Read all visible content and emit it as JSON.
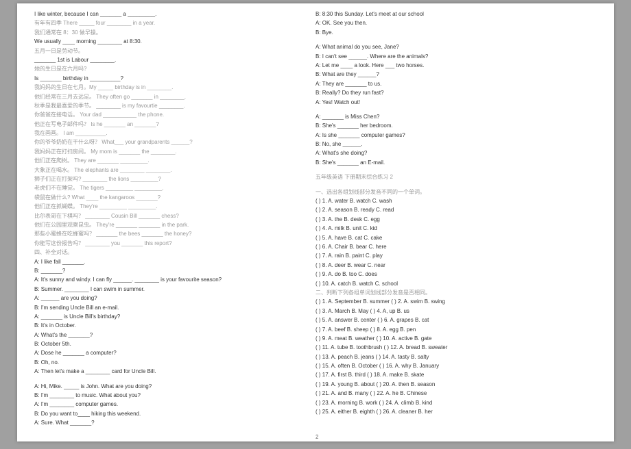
{
  "pageNum": "2",
  "left": [
    {
      "t": "I like winter, because I can _______ a _________.",
      "c": ""
    },
    {
      "t": "有年有四季    There _____ four ________ in a year.",
      "c": "gray"
    },
    {
      "t": "我们通常在 8：30 做早操。",
      "c": "gray"
    },
    {
      "t": "We usually ____ morning ________ at 8:30.",
      "c": ""
    },
    {
      "t": "五月一日是劳动节。",
      "c": "gray"
    },
    {
      "t": "_______ 1st is Labour ________.",
      "c": ""
    },
    {
      "t": "她的生日是在六月吗?",
      "c": "gray"
    },
    {
      "t": "Is _______ birthday in __________?",
      "c": ""
    },
    {
      "t": "我妈妈的生日在七月。My _____ birthday is in ________.",
      "c": "gray"
    },
    {
      "t": "他们经常在三月去远足。    They often go _______ in ________.",
      "c": "gray"
    },
    {
      "t": "秋季是我最喜爱的季节。    ________ is my favourtie ________.",
      "c": "gray"
    },
    {
      "t": "你爸爸在接电话。     Your dad ___________ the phone.",
      "c": "gray"
    },
    {
      "t": "他正在写电子邮件吗？    Is he _______ an _______?",
      "c": "gray"
    },
    {
      "t": "我在画画。    I am __________.",
      "c": "gray"
    },
    {
      "t": "你的爷爷奶奶在干什么呀？    What___ your grandparents ______?",
      "c": "gray"
    },
    {
      "t": "我妈妈正在打扫房间。    My mom is _______ the ________.",
      "c": "gray"
    },
    {
      "t": "他们正在爬树。    They are _______ _________.",
      "c": "gray"
    },
    {
      "t": "大象正在喝水。    The elephants are ________ ________.",
      "c": "gray"
    },
    {
      "t": "狮子们正在打架吗?    ________ the lions _________?",
      "c": "gray"
    },
    {
      "t": "老虎们不在睡觉。    The tigers _________ _________.",
      "c": "gray"
    },
    {
      "t": "袋鼠在做什么?    What ____ the kangaroos _______?",
      "c": "gray"
    },
    {
      "t": "他们正在抓蝴蝶。    They're _________ _________.",
      "c": "gray"
    },
    {
      "t": "比尔表哥在下棋吗？    ________ Cousin Bill _______ chess?",
      "c": "gray"
    },
    {
      "t": "他们在公园里观察昆虫。    They're _______ _______ in the park.",
      "c": "gray"
    },
    {
      "t": "那些小蜜蜂在吃蜂蜜吗？    _______ the bees _______ the honey?",
      "c": "gray"
    },
    {
      "t": "你能写这份报告吗？     ________ you _______ this report?",
      "c": "gray"
    },
    {
      "t": "四、补全对话。",
      "c": "gray"
    },
    {
      "t": "A: I like fall _______.",
      "c": ""
    },
    {
      "t": "B: _______?",
      "c": ""
    },
    {
      "t": "A: It's sunny and windy. I can fly ______. ________ is your favourite season?",
      "c": ""
    },
    {
      "t": "B: Summer. ________ I can swim in summer.",
      "c": ""
    },
    {
      "t": "A: ______ are you doing?",
      "c": ""
    },
    {
      "t": "B: I'm sending Uncle Bill an e-mail.",
      "c": ""
    },
    {
      "t": "A: _______ is Uncle Bill's birthday?",
      "c": ""
    },
    {
      "t": "B: It's in October.",
      "c": ""
    },
    {
      "t": "A: What's the _______?",
      "c": ""
    },
    {
      "t": "B: October 5th.",
      "c": ""
    },
    {
      "t": "A: Dose he _______ a computer?",
      "c": ""
    },
    {
      "t": "B: Oh, no.",
      "c": ""
    },
    {
      "t": "A: Then let's make a ________ card for Uncle Bill.",
      "c": ""
    },
    {
      "t": "",
      "c": "spacer"
    },
    {
      "t": "A: Hi, Mike. _____ is John. What are you doing?",
      "c": ""
    },
    {
      "t": "B: I'm ________ to music. What about you?",
      "c": ""
    },
    {
      "t": "A: I'm ________ computer games.",
      "c": ""
    },
    {
      "t": "B: Do you want to____ hiking this weekend.",
      "c": ""
    },
    {
      "t": "A: Sure. What _______?",
      "c": ""
    }
  ],
  "right": [
    {
      "t": "B: 8:30 this Sunday. Let's meet at our school",
      "c": ""
    },
    {
      "t": "A: OK. See you then.",
      "c": ""
    },
    {
      "t": "B: Bye.",
      "c": ""
    },
    {
      "t": "",
      "c": "spacer"
    },
    {
      "t": "A: What animal do you see, Jane?",
      "c": ""
    },
    {
      "t": "B: I can't see ______. Where are the animals?",
      "c": ""
    },
    {
      "t": "A: Let me ____ a look. Here ___ two horses.",
      "c": ""
    },
    {
      "t": "B: What are they ______?",
      "c": ""
    },
    {
      "t": "A: They are _______ to us.",
      "c": ""
    },
    {
      "t": "B: Really? Do they run fast?",
      "c": ""
    },
    {
      "t": "A: Yes! Watch out!",
      "c": ""
    },
    {
      "t": "",
      "c": "spacer"
    },
    {
      "t": "A: _______ is Miss Chen?",
      "c": ""
    },
    {
      "t": "B: She's _______ her bedroom.",
      "c": ""
    },
    {
      "t": "A: Is she _______ computer games?",
      "c": ""
    },
    {
      "t": "B: No, she ______.",
      "c": ""
    },
    {
      "t": "A: What's she doing?",
      "c": ""
    },
    {
      "t": "B: She's _______ an E-mail.",
      "c": ""
    },
    {
      "t": "",
      "c": "spacer"
    },
    {
      "t": "五年级英语 下册期末综合练习 2",
      "c": "gray"
    },
    {
      "t": "",
      "c": "spacer"
    },
    {
      "t": "一、选出各组划线部分发音不同的一个单词。",
      "c": "gray"
    },
    {
      "t": "(   ) 1. A. water    B. watch    C. wash",
      "c": ""
    },
    {
      "t": "(   ) 2. A. season   B. ready    C. read",
      "c": ""
    },
    {
      "t": "(   ) 3. A. the      B. desk     C. egg",
      "c": ""
    },
    {
      "t": "(   ) 4. A. milk     B. unit     C. kid",
      "c": ""
    },
    {
      "t": "(   ) 5. A. have     B. cat      C. cake",
      "c": ""
    },
    {
      "t": "(   ) 6. A. Chair    B. bear     C. here",
      "c": ""
    },
    {
      "t": "(   ) 7. A. rain     B. paint    C. play",
      "c": ""
    },
    {
      "t": "(   ) 8. A. deer     B. wear     C. near",
      "c": ""
    },
    {
      "t": "(   ) 9. A. do       B. too      C. does",
      "c": ""
    },
    {
      "t": "(   ) 10. A. catch   B. watch    C. school",
      "c": ""
    },
    {
      "t": "二、判断下列各组单词划线部分发音是否相同。",
      "c": "gray"
    },
    {
      "t": "(   ) 1. A. September   B. summer      (   ) 2. A. swim   B. swing",
      "c": ""
    },
    {
      "t": "(   ) 3. A. March       B. May         (   ) 4. A, up     B. us",
      "c": ""
    },
    {
      "t": "(   ) 5. A. answer      B. center      (   ) 6. A. grapes  B. cat",
      "c": ""
    },
    {
      "t": "(   ) 7. A. beef        B. sheep       (   ) 8. A. egg    B. pen",
      "c": ""
    },
    {
      "t": "(   ) 9. A. meat        B. weather     (   ) 10. A. active  B. gate",
      "c": ""
    },
    {
      "t": "(   ) 11. A. tube       B. toothbrush  (   ) 12. A. bread   B. sweater",
      "c": ""
    },
    {
      "t": "(   ) 13. A. peach      B. jeans       (   ) 14. A. tasty   B. salty",
      "c": ""
    },
    {
      "t": "(   ) 15. A. often      B. October     (   ) 16. A. why    B. January",
      "c": ""
    },
    {
      "t": "(   ) 17. A. first      B. third       (   ) 18. A. make    B. skate",
      "c": ""
    },
    {
      "t": "(   ) 19. A. young      B. about       (   ) 20. A. then    B. season",
      "c": ""
    },
    {
      "t": "(   ) 21. A. and        B. many        (   ) 22. A. he     B. Chinese",
      "c": ""
    },
    {
      "t": "(   ) 23. A. morning    B. work        (   ) 24. A. climb   B. kind",
      "c": ""
    },
    {
      "t": "(   ) 25. A. either     B. eighth      (   ) 26. A. cleaner  B. her",
      "c": ""
    }
  ]
}
